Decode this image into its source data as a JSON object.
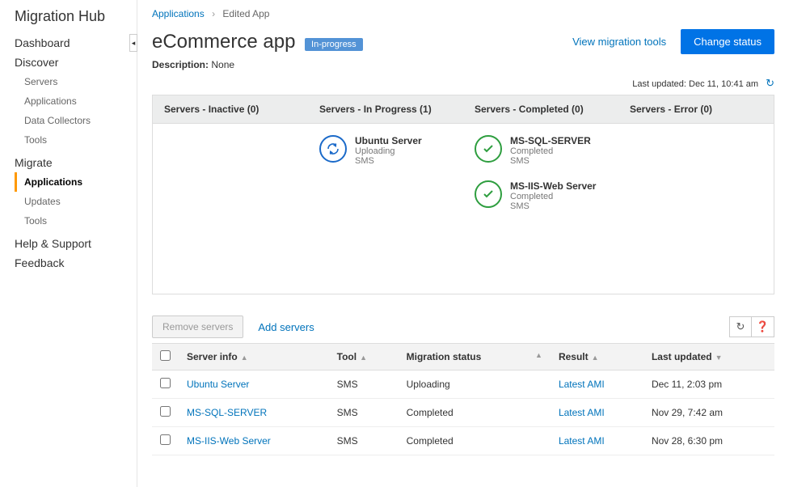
{
  "sidebar": {
    "title": "Migration Hub",
    "items": [
      {
        "label": "Dashboard",
        "type": "section"
      },
      {
        "label": "Discover",
        "type": "section"
      },
      {
        "label": "Servers",
        "type": "sub"
      },
      {
        "label": "Applications",
        "type": "sub"
      },
      {
        "label": "Data Collectors",
        "type": "sub"
      },
      {
        "label": "Tools",
        "type": "sub"
      },
      {
        "label": "Migrate",
        "type": "section"
      },
      {
        "label": "Applications",
        "type": "sub",
        "active": true
      },
      {
        "label": "Updates",
        "type": "sub"
      },
      {
        "label": "Tools",
        "type": "sub"
      },
      {
        "label": "Help & Support",
        "type": "section"
      },
      {
        "label": "Feedback",
        "type": "section"
      }
    ]
  },
  "breadcrumb": {
    "root": "Applications",
    "current": "Edited App"
  },
  "header": {
    "title": "eCommerce app",
    "badge": "In-progress",
    "view_tools": "View migration tools",
    "change_status": "Change status"
  },
  "description": {
    "label": "Description:",
    "value": "None"
  },
  "last_updated": {
    "label": "Last updated:",
    "value": "Dec 11, 10:41 am"
  },
  "status_columns": {
    "inactive": "Servers - Inactive (0)",
    "in_progress": "Servers - In Progress (1)",
    "completed": "Servers - Completed (0)",
    "error": "Servers - Error (0)"
  },
  "servers_in_progress": [
    {
      "name": "Ubuntu Server",
      "status": "Uploading",
      "tool": "SMS"
    }
  ],
  "servers_completed": [
    {
      "name": "MS-SQL-SERVER",
      "status": "Completed",
      "tool": "SMS"
    },
    {
      "name": "MS-IIS-Web Server",
      "status": "Completed",
      "tool": "SMS"
    }
  ],
  "table_actions": {
    "remove": "Remove servers",
    "add": "Add servers"
  },
  "table": {
    "headers": {
      "server_info": "Server info",
      "tool": "Tool",
      "migration_status": "Migration status",
      "result": "Result",
      "last_updated": "Last updated"
    },
    "rows": [
      {
        "server": "Ubuntu Server",
        "tool": "SMS",
        "status": "Uploading",
        "result": "Latest AMI",
        "updated": "Dec 11, 2:03 pm"
      },
      {
        "server": "MS-SQL-SERVER",
        "tool": "SMS",
        "status": "Completed",
        "result": "Latest AMI",
        "updated": "Nov 29, 7:42 am"
      },
      {
        "server": "MS-IIS-Web Server",
        "tool": "SMS",
        "status": "Completed",
        "result": "Latest AMI",
        "updated": "Nov 28, 6:30 pm"
      }
    ]
  }
}
